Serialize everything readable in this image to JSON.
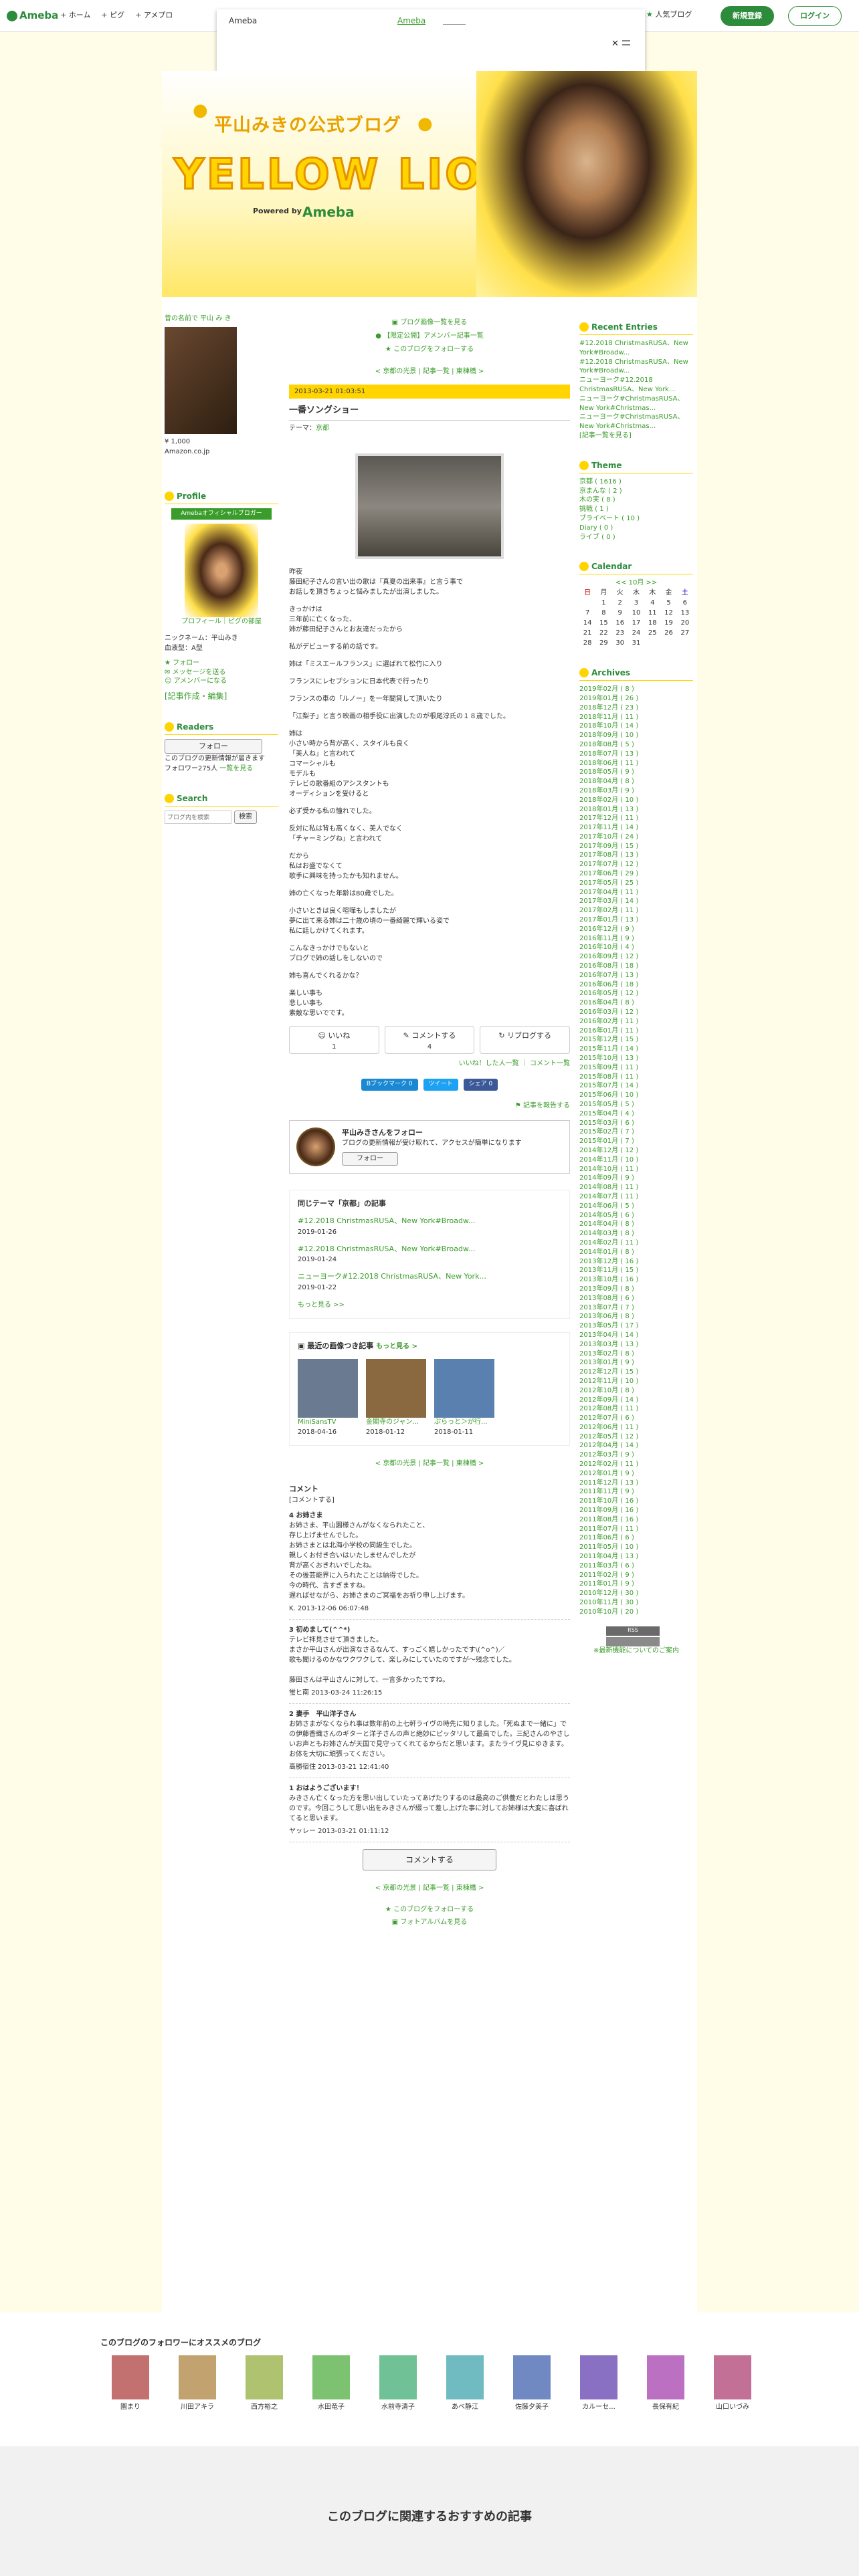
{
  "topbar": {
    "logo": "Ameba",
    "nav": [
      "ホーム",
      "ピグ",
      "アメプロ"
    ],
    "popular": "人気ブログ",
    "register": "新規登録",
    "login": "ログイン"
  },
  "popup": {
    "title": "Ameba",
    "accent": "Ameba"
  },
  "header": {
    "title": "平山みきの公式ブログ",
    "lion": "YELLOW LION",
    "powered": "Powered by",
    "ameba": "Ameba"
  },
  "left": {
    "amazon_link": "昔の名前で 平山 み き",
    "price": "¥ 1,000",
    "amazon": "Amazon.co.jp",
    "profile_head": "Profile",
    "official_badge": "Amebaオフィシャルブロガー",
    "profile_caption": "プロフィール｜ピグの部屋",
    "nickname": "ニックネーム：平山みき",
    "blood": "血液型：A型",
    "links": [
      "フォロー",
      "メッセージを送る",
      "アメンバーになる"
    ],
    "record": "[記事作成・編集]",
    "readers_head": "Readers",
    "follow_btn": "フォロー",
    "readers_note": "このブログの更新情報が届きます",
    "followers": "フォロワー275人",
    "followers_link": "一覧を見る",
    "search_head": "Search",
    "search_placeholder": "ブログ内を検索",
    "search_btn": "検索"
  },
  "center": {
    "top_links": [
      "ブログ画像一覧を見る",
      "【限定公開】アメンバー記事一覧",
      "このブログをフォローする"
    ],
    "nav": "< 京都の光景 | 記事一覧 | 東棟橋 >",
    "date": "2013-03-21 01:03:51",
    "title": "一番ソングショー",
    "theme": "テーマ：",
    "theme_link": "京都",
    "body": [
      "昨夜\n藤田紀子さんの言い出の歌は『真夏の出来事』と言う事で\nお話しを頂きちょっと悩みましたが出演しました。",
      "きっかけは\n三年前に亡くなった、\n姉が藤田紀子さんとお友達だったから",
      "私がデビューする前の話です。",
      "姉は「ミスエールフランス」に選ばれて松竹に入り",
      "フランスにレセプションに日本代表で行ったり",
      "フランスの車の「ルノー」を一年間貸して頂いたり",
      "「江梨子」と言う映画の相手役に出演したのが根尾淳氏の１８歳でした。",
      "姉は\n小さい時から背が高く、スタイルも良く\n「美人ね」と言われて\nコマーシャルも\nモデルも\nテレビの歌番組のアシスタントも\nオーディションを受けると",
      "必ず受かる私の憧れでした。",
      "反対に私は背も高くなく、美人でなく\n「チャーミングね」と言われて",
      "だから\n私はお盛でなくて\n歌手に興味を持ったかも知れません。",
      "姉の亡くなった年齢は80歳でした。",
      "小さいときは良く喧嘩もしましたが\n夢に出て来る姉は二十歳の頃の一番綺麗で輝いる姿で\n私に話しかけてくれます。",
      "こんなきっかけでもないと\nブログで姉の話しをしないので",
      "姉も喜んでくれるかな？",
      "楽しい事も\n悲しい事も\n素敵な思いでです。"
    ],
    "like": "いいね",
    "like_count": "1",
    "comment": "コメントする",
    "comment_count": "4",
    "reblog": "リブログする",
    "like_link": "いいね！した人一覧",
    "comment_link": "コメント一覧",
    "share": [
      "Bブックマーク 0",
      "ツイート",
      "シェア 0"
    ],
    "report": "記事を報告する",
    "follow_title": "平山みきさんをフォロー",
    "follow_sub": "ブログの更新情報が受け取れて、アクセスが簡単になります",
    "follow_btn": "フォロー",
    "same_head": "同じテーマ「京都」の記事",
    "same": [
      {
        "t": "#12.2018 ChristmasRUSA、New York#Broadw...",
        "d": "2019-01-26"
      },
      {
        "t": "#12.2018 ChristmasRUSA、New York#Broadw...",
        "d": "2019-01-24"
      },
      {
        "t": "ニューヨーク#12.2018 ChristmasRUSA、New York...",
        "d": "2019-01-22"
      }
    ],
    "same_more": "もっと見る >>",
    "latest_head": "最近の画像つき記事",
    "latest_more": "もっと見る >",
    "thumbs": [
      {
        "t": "MiniSansTV",
        "d": "2018-04-16"
      },
      {
        "t": "金閣寺のジャン...",
        "d": "2018-01-12"
      },
      {
        "t": "ぷらっと＞が行...",
        "d": "2018-01-11"
      }
    ],
    "comments_head": "コメント",
    "comments_sub": "[コメントする]",
    "comments": [
      {
        "n": "4 お姉さま",
        "b": "お姉さま、平山園様さんがなくなられたこと、\n存じ上げませんでした。\nお姉さまとは北海小学校の同級生でした。\n親しくお付き合いはいたしませんでしたが\n背が高くおきれいでしたね。\nその後芸能界に入られたことは納得でした。\n今の時代、言すぎますね。\n遅ればせながら、お姉さまのご冥福をお祈り申し上げます。",
        "m": "K. 2013-12-06 06:07:48"
      },
      {
        "n": "3 初めまして(^^*)",
        "b": "テレビ拝見させて頂きました。\nまさか平山さんが出演なさるなんて、すっごく嬉しかったです\\(^o^)／\n歌も聞けるのかなワクワクして、楽しみにしていたのですが～残念でした。\n\n藤田さんは平山さんに対して、一言多かったですね。",
        "m": "蛍ヒ南 2013-03-24 11:26:15"
      },
      {
        "n": "2 妻手　平山洋子さん",
        "b": "お姉さまがなくなられ事は数年前の上七軒ライヴの時先に知りました。「死ぬまで一緒に」での伊藤香織さんのギターと洋子さんの声と絶妙にピッタリして最高でした。三紀さんのやさしいお声ともお姉さんが天国で見守ってくれてるからだと思います。またライヴ見にゆきます。お体を大切に頑張ってください。",
        "m": "高勝宿住 2013-03-21 12:41:40"
      },
      {
        "n": "1 おはようございます！",
        "b": "みきさん亡くなった方を思い出していたってあげたりするのは最高のご供養だとわたしは思うのです。今回こうして思い出をみきさんが綴って差し上げた事に対してお姉様は大変に喜ばれてると思います。",
        "m": "ヤッレー 2013-03-21 01:11:12"
      }
    ],
    "comment_btn": "コメントする",
    "follow_link": "このブログをフォローする",
    "photo_link": "フォトアルバムを見る"
  },
  "right": {
    "recent_head": "Recent Entries",
    "recent": [
      "#12.2018 ChristmasRUSA、New York#Broadw...",
      "#12.2018 ChristmasRUSA、New York#Broadw...",
      "ニューヨーク#12.2018 ChristmasRUSA、New York...",
      "ニューヨーク#ChristmasRUSA、New York#Christmas...",
      "ニューヨーク#ChristmasRUSA、New York#Christmas..."
    ],
    "recent_more": "[記事一覧を見る]",
    "theme_head": "Theme",
    "themes": [
      "京都 ( 1616 )",
      "京まんな ( 2 )",
      "木の実 ( 8 )",
      "挑戦 ( 1 )",
      "ブライベート ( 10 )",
      "Diary ( 0 )",
      "ライブ ( 0 )"
    ],
    "calendar_head": "Calendar",
    "cal_title": "<< 10月 >>",
    "cal_week": [
      "日",
      "月",
      "火",
      "水",
      "木",
      "金",
      "土"
    ],
    "cal_days": [
      [
        "",
        "1",
        "2",
        "3",
        "4",
        "5",
        "6"
      ],
      [
        "7",
        "8",
        "9",
        "10",
        "11",
        "12",
        "13"
      ],
      [
        "14",
        "15",
        "16",
        "17",
        "18",
        "19",
        "20"
      ],
      [
        "21",
        "22",
        "23",
        "24",
        "25",
        "26",
        "27"
      ],
      [
        "28",
        "29",
        "30",
        "31",
        "",
        "",
        ""
      ]
    ],
    "archives_head": "Archives",
    "archives": [
      "2019年02月 ( 8 )",
      "2019年01月 ( 26 )",
      "2018年12月 ( 23 )",
      "2018年11月 ( 11 )",
      "2018年10月 ( 14 )",
      "2018年09月 ( 10 )",
      "2018年08月 ( 5 )",
      "2018年07月 ( 13 )",
      "2018年06月 ( 11 )",
      "2018年05月 ( 9 )",
      "2018年04月 ( 8 )",
      "2018年03月 ( 9 )",
      "2018年02月 ( 10 )",
      "2018年01月 ( 13 )",
      "2017年12月 ( 11 )",
      "2017年11月 ( 14 )",
      "2017年10月 ( 24 )",
      "2017年09月 ( 15 )",
      "2017年08月 ( 13 )",
      "2017年07月 ( 12 )",
      "2017年06月 ( 29 )",
      "2017年05月 ( 25 )",
      "2017年04月 ( 11 )",
      "2017年03月 ( 14 )",
      "2017年02月 ( 11 )",
      "2017年01月 ( 13 )",
      "2016年12月 ( 9 )",
      "2016年11月 ( 9 )",
      "2016年10月 ( 4 )",
      "2016年09月 ( 12 )",
      "2016年08月 ( 18 )",
      "2016年07月 ( 13 )",
      "2016年06月 ( 18 )",
      "2016年05月 ( 12 )",
      "2016年04月 ( 8 )",
      "2016年03月 ( 12 )",
      "2016年02月 ( 11 )",
      "2016年01月 ( 11 )",
      "2015年12月 ( 15 )",
      "2015年11月 ( 14 )",
      "2015年10月 ( 13 )",
      "2015年09月 ( 11 )",
      "2015年08月 ( 11 )",
      "2015年07月 ( 14 )",
      "2015年06月 ( 10 )",
      "2015年05月 ( 5 )",
      "2015年04月 ( 4 )",
      "2015年03月 ( 6 )",
      "2015年02月 ( 7 )",
      "2015年01月 ( 7 )",
      "2014年12月 ( 12 )",
      "2014年11月 ( 10 )",
      "2014年10月 ( 11 )",
      "2014年09月 ( 9 )",
      "2014年08月 ( 11 )",
      "2014年07月 ( 11 )",
      "2014年06月 ( 5 )",
      "2014年05月 ( 6 )",
      "2014年04月 ( 8 )",
      "2014年03月 ( 8 )",
      "2014年02月 ( 11 )",
      "2014年01月 ( 8 )",
      "2013年12月 ( 16 )",
      "2013年11月 ( 15 )",
      "2013年10月 ( 16 )",
      "2013年09月 ( 8 )",
      "2013年08月 ( 6 )",
      "2013年07月 ( 7 )",
      "2013年06月 ( 8 )",
      "2013年05月 ( 17 )",
      "2013年04月 ( 14 )",
      "2013年03月 ( 13 )",
      "2013年02月 ( 8 )",
      "2013年01月 ( 9 )",
      "2012年12月 ( 15 )",
      "2012年11月 ( 10 )",
      "2012年10月 ( 8 )",
      "2012年09月 ( 14 )",
      "2012年08月 ( 11 )",
      "2012年07月 ( 6 )",
      "2012年06月 ( 11 )",
      "2012年05月 ( 12 )",
      "2012年04月 ( 14 )",
      "2012年03月 ( 9 )",
      "2012年02月 ( 11 )",
      "2012年01月 ( 9 )",
      "2011年12月 ( 13 )",
      "2011年11月 ( 9 )",
      "2011年10月 ( 16 )",
      "2011年09月 ( 16 )",
      "2011年08月 ( 16 )",
      "2011年07月 ( 11 )",
      "2011年06月 ( 6 )",
      "2011年05月 ( 10 )",
      "2011年04月 ( 13 )",
      "2011年03月 ( 6 )",
      "2011年02月 ( 9 )",
      "2011年01月 ( 9 )",
      "2010年12月 ( 30 )",
      "2010年11月 ( 30 )",
      "2010年10月 ( 20 )"
    ],
    "rss": "RSS",
    "rss_link": "※最新機能についてのご案内"
  },
  "recommend": {
    "head": "このブログのフォロワーにオススメのブログ",
    "items": [
      "園まり",
      "川田アキラ",
      "西方裕之",
      "水田竜子",
      "水前寺清子",
      "あべ静江",
      "佐藤夕美子",
      "カルーセ...",
      "長保有紀",
      "山口いづみ"
    ]
  },
  "bottom": {
    "head": "このブログに関連するおすすめの記事"
  }
}
